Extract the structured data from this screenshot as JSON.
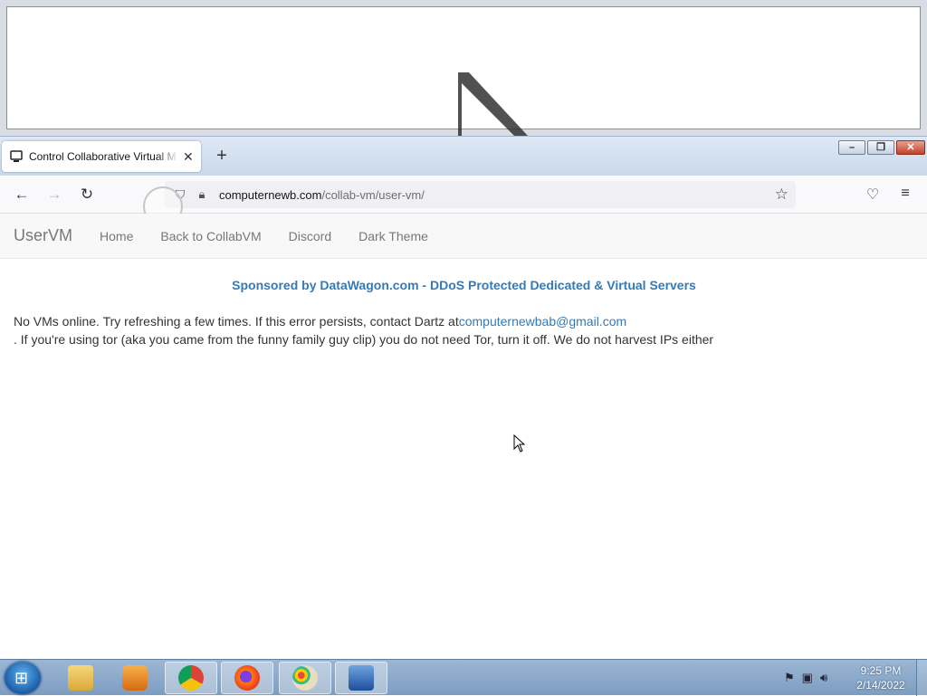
{
  "browser": {
    "tab": {
      "title": "Control Collaborative Virtual M",
      "close": "✕"
    },
    "new_tab": "+",
    "window_controls": {
      "minimize": "–",
      "maximize": "❐",
      "close": "✕"
    },
    "nav": {
      "back": "←",
      "forward": "→",
      "reload": "↻"
    },
    "url": {
      "host": "computernewb.com",
      "path": "/collab-vm/user-vm/"
    },
    "icons": {
      "pocket": "♡",
      "menu": "≡",
      "bookmark": "☆"
    }
  },
  "site": {
    "brand": "UserVM",
    "nav": [
      "Home",
      "Back to CollabVM",
      "Discord",
      "Dark Theme"
    ],
    "sponsor": "Sponsored by DataWagon.com - DDoS Protected Dedicated & Virtual Servers",
    "message_part1": "No VMs online. Try refreshing a few times. If this error persists, contact Dartz at",
    "email": "computernewbab@gmail.com",
    "message_part2": ". If you're using tor (aka you came from the funny family guy clip) you do not need Tor, turn it off. We do not harvest IPs either"
  },
  "taskbar": {
    "start_glyph": "⊞",
    "items": [
      "explorer",
      "media-player",
      "chrome",
      "firefox",
      "paint",
      "network-app"
    ],
    "clock": {
      "time": "9:25 PM",
      "date": "2/14/2022"
    }
  },
  "colors": {
    "link": "#337ab7",
    "taskbar": "#8aa9cb"
  }
}
